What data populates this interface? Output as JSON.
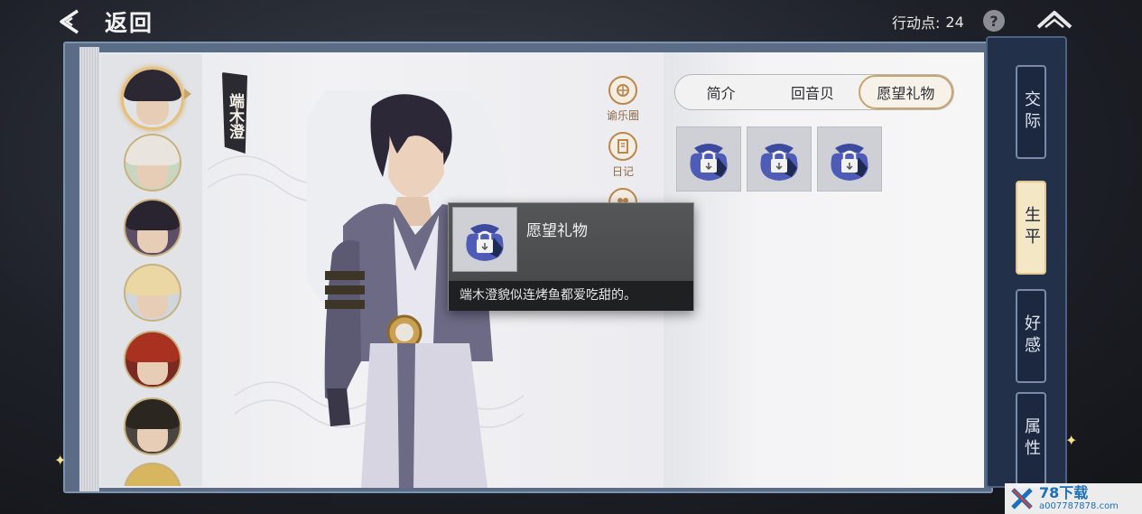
{
  "header": {
    "back_label": "返回",
    "action_points_label": "行动点:",
    "action_points_value": "24",
    "help_glyph": "?"
  },
  "character": {
    "name": "端木澄"
  },
  "tools": [
    {
      "label": "谕乐圈",
      "icon": "music-circle-icon"
    },
    {
      "label": "日记",
      "icon": "diary-icon"
    }
  ],
  "tabs": [
    {
      "label": "简介",
      "active": false
    },
    {
      "label": "回音贝",
      "active": false
    },
    {
      "label": "愿望礼物",
      "active": true
    }
  ],
  "gifts": [
    {
      "icon": "locked-gift-bag-icon"
    },
    {
      "icon": "locked-gift-bag-icon"
    },
    {
      "icon": "locked-gift-bag-icon"
    }
  ],
  "tooltip": {
    "title": "愿望礼物",
    "description": "端木澄貌似连烤鱼都爱吃甜的。"
  },
  "right_nav": [
    {
      "label": "交际",
      "active": false
    },
    {
      "label": "生平",
      "active": true
    },
    {
      "label": "好感",
      "active": false
    },
    {
      "label": "属性",
      "active": false
    }
  ],
  "watermark": {
    "brand": "78下载",
    "url": "a007787878.com"
  },
  "colors": {
    "accent_gold": "#c9a46a",
    "nav_bg": "#223049",
    "tooltip_bg": "#4a4b4d"
  }
}
